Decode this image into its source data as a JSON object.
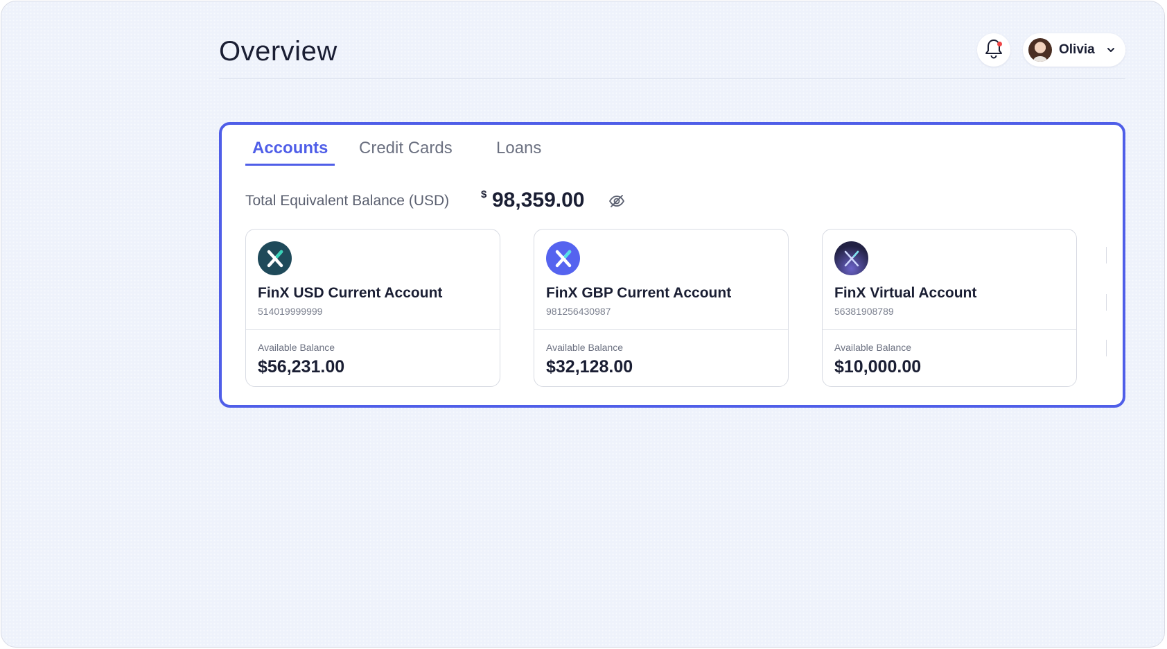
{
  "header": {
    "title": "Overview",
    "user": {
      "name": "Olivia"
    },
    "icons": {
      "bell": "bell-icon",
      "chevron": "chevron-down-icon"
    },
    "notification_dot_color": "#ef4444"
  },
  "panel": {
    "accent_color": "#4f5ee8",
    "tabs": [
      {
        "label": "Accounts",
        "active": true
      },
      {
        "label": "Credit Cards",
        "active": false
      },
      {
        "label": "Loans",
        "active": false
      }
    ],
    "balance": {
      "label": "Total Equivalent Balance (USD)",
      "currency_symbol": "$",
      "value": "98,359.00",
      "toggle_icon": "eye-off-icon"
    },
    "accounts": [
      {
        "name": "FinX USD Current Account",
        "number": "514019999999",
        "available_label": "Available Balance",
        "available_value": "$56,231.00",
        "logo_color": "#1f4a5a",
        "logo_icon": "finx-logo-icon"
      },
      {
        "name": "FinX GBP Current Account",
        "number": "981256430987",
        "available_label": "Available Balance",
        "available_value": "$32,128.00",
        "logo_color": "#5563ef",
        "logo_icon": "finx-logo-icon"
      },
      {
        "name": "FinX Virtual Account",
        "number": "56381908789",
        "available_label": "Available Balance",
        "available_value": "$10,000.00",
        "logo_color": "#232244",
        "logo_icon": "finx-logo-icon"
      }
    ]
  }
}
